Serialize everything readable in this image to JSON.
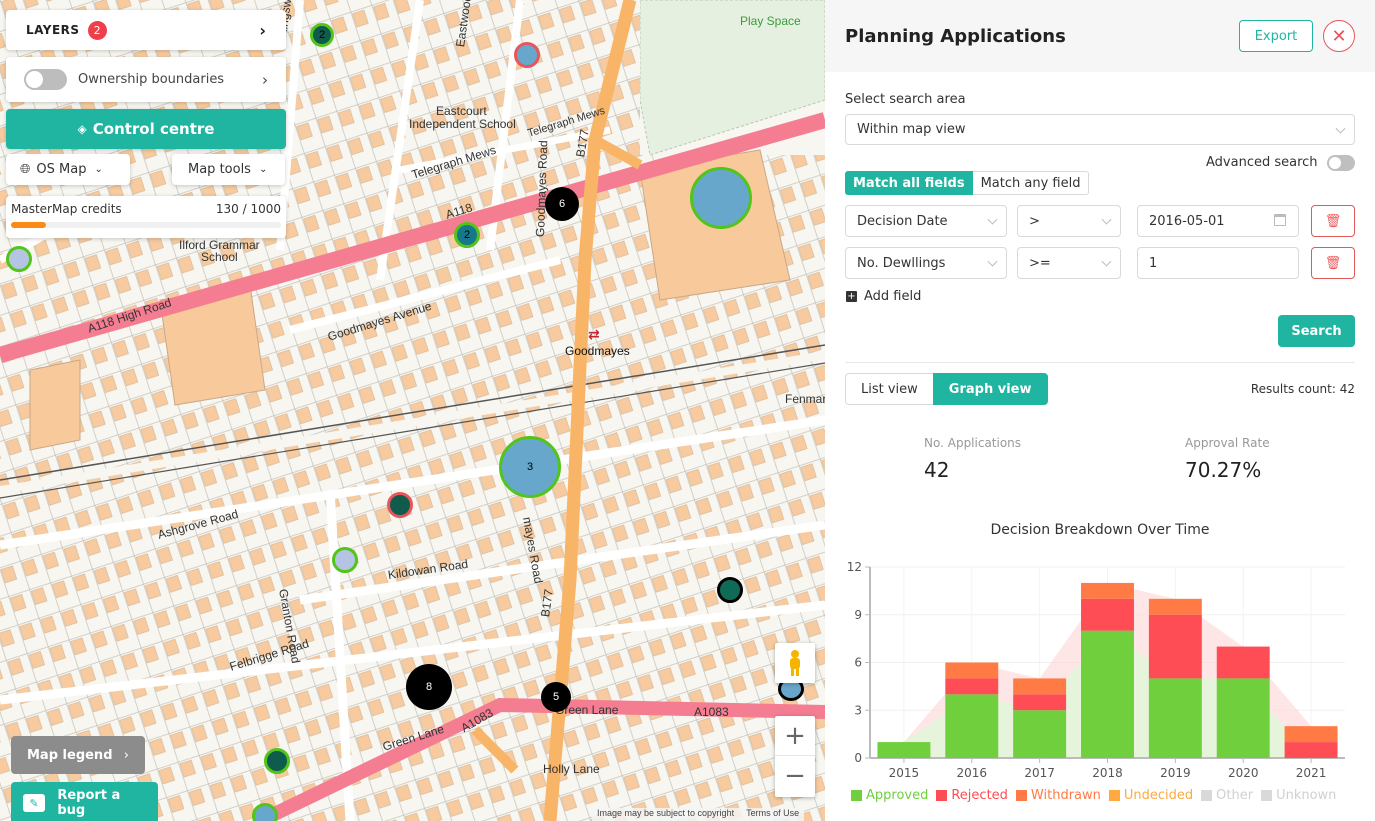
{
  "map": {
    "layers_label": "LAYERS",
    "layers_count": "2",
    "ownership_label": "Ownership boundaries",
    "control_centre_label": "Control centre",
    "os_map_label": "OS Map",
    "map_tools_label": "Map tools",
    "credits_label": "MasterMap credits",
    "credits_value": "130 / 1000",
    "credits_fraction": 0.13,
    "map_legend_label": "Map legend",
    "report_bug_label": "Report a bug",
    "copyright": "Image may be subject to copyright",
    "terms": "Terms of Use",
    "labels": {
      "play_space": "Play Space",
      "eastcourt": "Eastcourt",
      "independent_school": "Independent School",
      "telegraph_mews": "Telegraph Mews",
      "telegraph_mews2": "Telegraph Mews",
      "eastwood_road": "Eastwood Road",
      "kingsw": "Kingsw",
      "a118_top": "A118",
      "b177_top": "B177",
      "goodmayes_road": "Goodmayes Road",
      "ilford_grammar": "Ilford Grammar",
      "school": "School",
      "high_road": "A118   High Road",
      "goodmayes_avenue": "Goodmayes Avenue",
      "goodmayes": "Goodmayes",
      "fenman": "Fenman",
      "ashgrove_road": "Ashgrove Road",
      "kildowan_road": "Kildowan Road",
      "granton_road": "Granton Road",
      "felbrigge_road": "Felbrigge Road",
      "mayes_road": "mayes Road",
      "b177_mid": "B177",
      "green_lane_left": "Green Lane",
      "a1083_left": "A1083",
      "green_lane_right": "Green Lane",
      "a1083_right": "A1083",
      "holly_lane": "Holly Lane"
    },
    "markers": [
      {
        "label": "2"
      },
      {
        "label": ""
      },
      {
        "label": "6"
      },
      {
        "label": "2"
      },
      {
        "label": ""
      },
      {
        "label": ""
      },
      {
        "label": "3"
      },
      {
        "label": ""
      },
      {
        "label": ""
      },
      {
        "label": ""
      },
      {
        "label": "8"
      },
      {
        "label": "5"
      },
      {
        "label": ""
      },
      {
        "label": ""
      },
      {
        "label": ""
      }
    ]
  },
  "panel": {
    "title": "Planning Applications",
    "export_label": "Export",
    "search_area_label": "Select search area",
    "search_area_value": "Within map view",
    "advanced_search_label": "Advanced search",
    "match_all_label": "Match all fields",
    "match_any_label": "Match any field",
    "filters": [
      {
        "field": "Decision Date",
        "operator": ">",
        "value": "2016-05-01"
      },
      {
        "field": "No. Dewllings",
        "operator": ">=",
        "value": "1"
      }
    ],
    "add_field_label": "Add field",
    "search_label": "Search",
    "list_view_label": "List view",
    "graph_view_label": "Graph view",
    "results_count": "Results count: 42",
    "stats": {
      "applications_label": "No. Applications",
      "applications_value": "42",
      "approval_label": "Approval Rate",
      "approval_value": "70.27%"
    }
  },
  "chart_data": {
    "type": "bar",
    "stacked": true,
    "title": "Decision Breakdown Over Time",
    "categories": [
      "2015",
      "2016",
      "2017",
      "2018",
      "2019",
      "2020",
      "2021"
    ],
    "series": [
      {
        "name": "Approved",
        "color": "#6fcf3c",
        "values": [
          1,
          4,
          3,
          8,
          5,
          5,
          0
        ]
      },
      {
        "name": "Rejected",
        "color": "#ff4d55",
        "values": [
          0,
          1,
          1,
          2,
          4,
          2,
          1
        ]
      },
      {
        "name": "Withdrawn",
        "color": "#ff7a45",
        "values": [
          0,
          1,
          1,
          1,
          1,
          0,
          1
        ]
      },
      {
        "name": "Undecided",
        "color": "#ffa940",
        "values": [
          0,
          0,
          0,
          0,
          0,
          0,
          0
        ]
      },
      {
        "name": "Other",
        "color": "#d9d9d9",
        "values": [
          0,
          0,
          0,
          0,
          0,
          0,
          0
        ]
      },
      {
        "name": "Unknown",
        "color": "#d9d9d9",
        "values": [
          0,
          0,
          0,
          0,
          0,
          0,
          0
        ]
      }
    ],
    "yticks": [
      "0",
      "3",
      "6",
      "9",
      "12"
    ],
    "ylim": [
      0,
      12
    ],
    "xlabel": "",
    "ylabel": "",
    "grid": true,
    "legend": "bottom"
  }
}
